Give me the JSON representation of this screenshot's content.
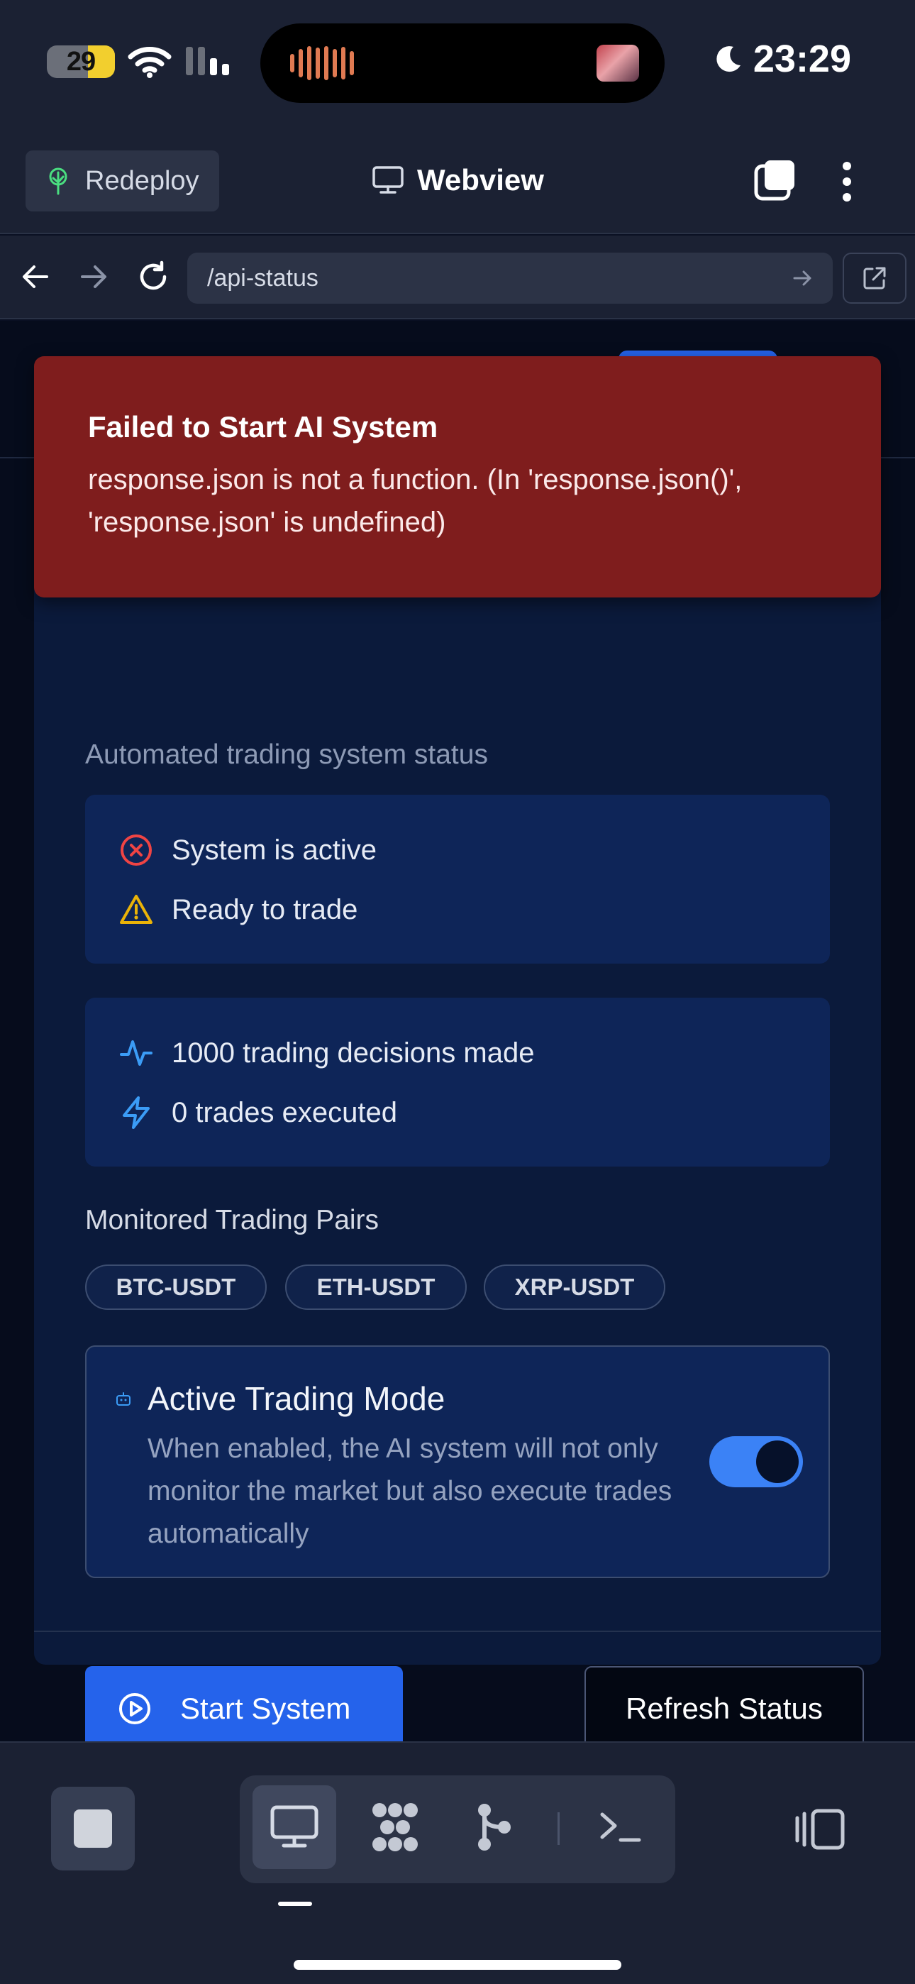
{
  "status_bar": {
    "battery_level": "29",
    "battery_percent": 29,
    "time": "23:29"
  },
  "app_header": {
    "redeploy_label": "Redeploy",
    "title": "Webview"
  },
  "url_bar": {
    "url": "/api-status"
  },
  "error_toast": {
    "title": "Failed to Start AI System",
    "message": "response.json is not a function. (In 'response.json()', 'response.json' is undefined)"
  },
  "ai_status": {
    "subtitle": "Automated trading system status",
    "system_active": "System is active",
    "ready_to_trade": "Ready to trade",
    "decisions": "1000 trading decisions made",
    "trades": "0 trades executed",
    "pairs_title": "Monitored Trading Pairs",
    "pairs": [
      "BTC-USDT",
      "ETH-USDT",
      "XRP-USDT"
    ],
    "mode": {
      "title": "Active Trading Mode",
      "description": "When enabled, the AI system will not only monitor the market but also execute trades automatically",
      "enabled": true
    },
    "start_button": "Start System",
    "refresh_button": "Refresh Status"
  },
  "colors": {
    "accent_blue": "#2563eb",
    "error_red": "#7f1d1d",
    "status_error": "#ef4444",
    "status_warning": "#eab308",
    "icon_blue": "#3b9cf6"
  },
  "icons": {
    "status_bar": [
      "wifi-icon",
      "cellular-signal-icon",
      "moon-icon"
    ],
    "header": [
      "tree-icon",
      "monitor-icon",
      "tabs-icon",
      "more-vertical-icon"
    ],
    "url_bar": [
      "arrow-left-icon",
      "arrow-right-icon",
      "reload-icon",
      "go-arrow-icon",
      "external-link-icon"
    ],
    "content": [
      "x-circle-icon",
      "warning-triangle-icon",
      "activity-icon",
      "zap-icon",
      "robot-icon",
      "play-circle-icon"
    ],
    "bottom_bar": [
      "stop-icon",
      "monitor-icon",
      "packages-icon",
      "fork-icon",
      "terminal-icon",
      "layout-icon"
    ]
  }
}
